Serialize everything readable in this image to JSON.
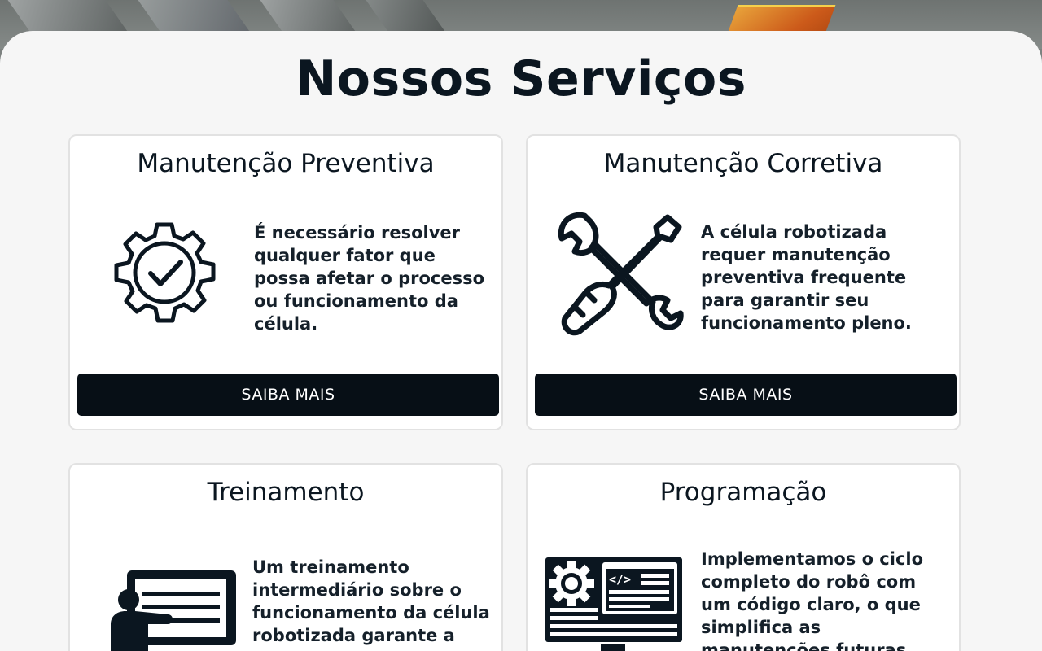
{
  "page": {
    "title": "Nossos Serviços"
  },
  "services": [
    {
      "title": "Manutenção Preventiva",
      "icon": "gear-check-icon",
      "description": "É necessário resolver qualquer fator que possa afetar o processo ou funcionamento da célula.",
      "button_label": "SAIBA MAIS"
    },
    {
      "title": "Manutenção Corretiva",
      "icon": "wrench-screwdriver-icon",
      "description": "A célula robotizada requer manutenção preventiva frequente para garantir seu funcionamento pleno.",
      "button_label": "SAIBA MAIS"
    },
    {
      "title": "Treinamento",
      "icon": "teacher-board-icon",
      "description": "Um treinamento intermediário sobre o funcionamento da célula robotizada garante a"
    },
    {
      "title": "Programação",
      "icon": "computer-code-icon",
      "description": "Implementamos o ciclo completo do robô com um código claro, o que simplifica as manutenções futuras"
    }
  ],
  "colors": {
    "panel_background": "#f6f6f6",
    "title_text": "#0b1620",
    "button_background": "#070f16",
    "button_text": "#ffffff",
    "accent_orange": "#cc5a1a"
  }
}
